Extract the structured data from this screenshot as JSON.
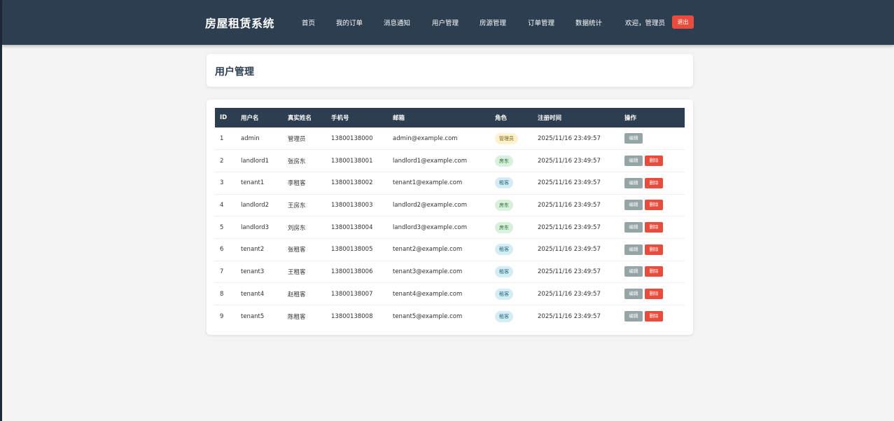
{
  "nav": {
    "brand": "房屋租赁系统",
    "items": [
      "首页",
      "我的订单",
      "消息通知",
      "用户管理",
      "房源管理",
      "订单管理",
      "数据统计"
    ],
    "welcome": "欢迎，管理员",
    "logout": "退出"
  },
  "page": {
    "title": "用户管理"
  },
  "table": {
    "headers": [
      "ID",
      "用户名",
      "真实姓名",
      "手机号",
      "邮箱",
      "角色",
      "注册时间",
      "操作"
    ],
    "edit_label": "编辑",
    "delete_label": "删除",
    "rows": [
      {
        "id": "1",
        "username": "admin",
        "realname": "管理员",
        "phone": "13800138000",
        "email": "admin@example.com",
        "role": "管理员",
        "role_type": "admin",
        "registered": "2025/11/16 23:49:57",
        "deletable": false
      },
      {
        "id": "2",
        "username": "landlord1",
        "realname": "张房东",
        "phone": "13800138001",
        "email": "landlord1@example.com",
        "role": "房东",
        "role_type": "landlord",
        "registered": "2025/11/16 23:49:57",
        "deletable": true
      },
      {
        "id": "3",
        "username": "tenant1",
        "realname": "李租客",
        "phone": "13800138002",
        "email": "tenant1@example.com",
        "role": "租客",
        "role_type": "tenant",
        "registered": "2025/11/16 23:49:57",
        "deletable": true
      },
      {
        "id": "4",
        "username": "landlord2",
        "realname": "王房东",
        "phone": "13800138003",
        "email": "landlord2@example.com",
        "role": "房东",
        "role_type": "landlord",
        "registered": "2025/11/16 23:49:57",
        "deletable": true
      },
      {
        "id": "5",
        "username": "landlord3",
        "realname": "刘房东",
        "phone": "13800138004",
        "email": "landlord3@example.com",
        "role": "房东",
        "role_type": "landlord",
        "registered": "2025/11/16 23:49:57",
        "deletable": true
      },
      {
        "id": "6",
        "username": "tenant2",
        "realname": "张租客",
        "phone": "13800138005",
        "email": "tenant2@example.com",
        "role": "租客",
        "role_type": "tenant",
        "registered": "2025/11/16 23:49:57",
        "deletable": true
      },
      {
        "id": "7",
        "username": "tenant3",
        "realname": "王租客",
        "phone": "13800138006",
        "email": "tenant3@example.com",
        "role": "租客",
        "role_type": "tenant",
        "registered": "2025/11/16 23:49:57",
        "deletable": true
      },
      {
        "id": "8",
        "username": "tenant4",
        "realname": "赵租客",
        "phone": "13800138007",
        "email": "tenant4@example.com",
        "role": "租客",
        "role_type": "tenant",
        "registered": "2025/11/16 23:49:57",
        "deletable": true
      },
      {
        "id": "9",
        "username": "tenant5",
        "realname": "陈租客",
        "phone": "13800138008",
        "email": "tenant5@example.com",
        "role": "租客",
        "role_type": "tenant",
        "registered": "2025/11/16 23:49:57",
        "deletable": true
      }
    ]
  },
  "colors": {
    "navbar": "#2c3e50",
    "danger": "#e74c3c",
    "edit": "#95a5a6"
  }
}
